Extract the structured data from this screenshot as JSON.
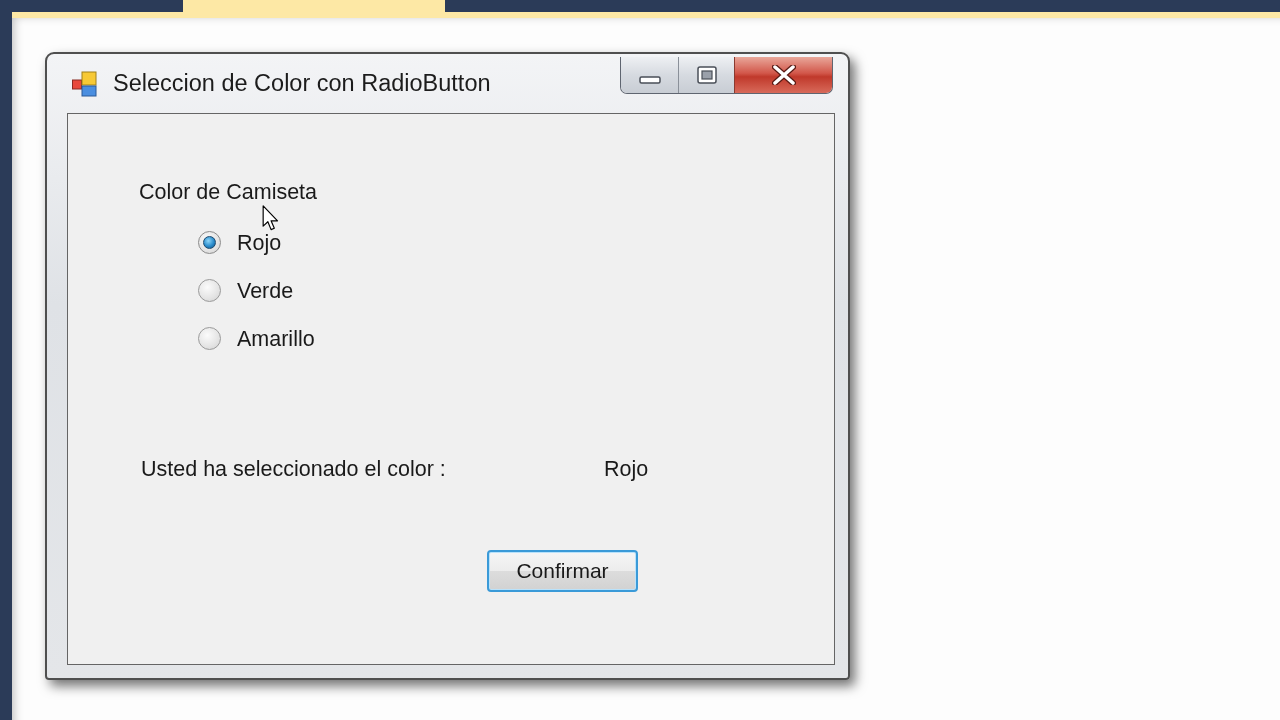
{
  "window": {
    "title": "Seleccion de Color con RadioButton"
  },
  "group_label": "Color de Camiseta",
  "radios": [
    {
      "label": "Rojo",
      "selected": true
    },
    {
      "label": "Verde",
      "selected": false
    },
    {
      "label": "Amarillo",
      "selected": false
    }
  ],
  "result": {
    "label": "Usted ha seleccionado el color :",
    "value": "Rojo"
  },
  "button": {
    "label": "Confirmar",
    "focused": true
  }
}
